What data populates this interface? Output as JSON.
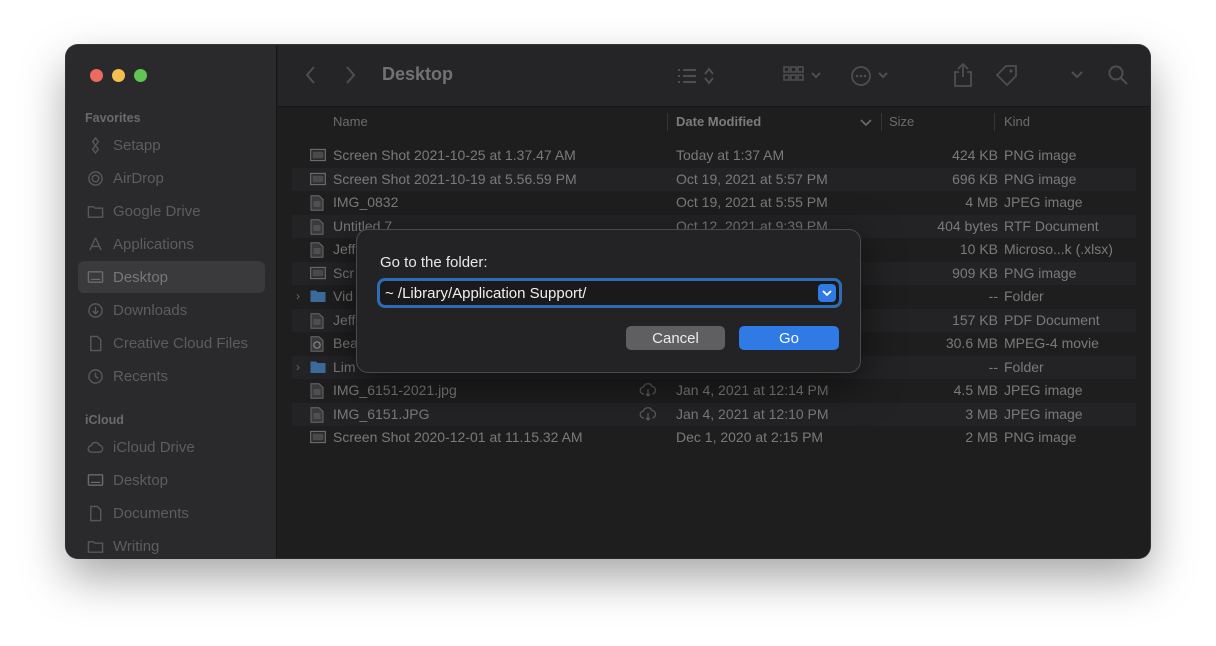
{
  "window": {
    "title": "Desktop"
  },
  "sidebar": {
    "favorites_title": "Favorites",
    "icloud_title": "iCloud",
    "favorites": [
      {
        "label": "Setapp",
        "icon": "setapp-icon"
      },
      {
        "label": "AirDrop",
        "icon": "airdrop-icon"
      },
      {
        "label": "Google Drive",
        "icon": "folder-icon"
      },
      {
        "label": "Applications",
        "icon": "applications-icon"
      },
      {
        "label": "Desktop",
        "icon": "desktop-icon",
        "selected": true
      },
      {
        "label": "Downloads",
        "icon": "downloads-icon"
      },
      {
        "label": "Creative Cloud Files",
        "icon": "document-icon"
      },
      {
        "label": "Recents",
        "icon": "clock-icon"
      }
    ],
    "icloud": [
      {
        "label": "iCloud Drive",
        "icon": "cloud-icon"
      },
      {
        "label": "Desktop",
        "icon": "desktop-icon"
      },
      {
        "label": "Documents",
        "icon": "document-icon"
      },
      {
        "label": "Writing",
        "icon": "folder-icon"
      }
    ]
  },
  "columns": {
    "name": "Name",
    "date": "Date Modified",
    "size": "Size",
    "kind": "Kind"
  },
  "files": [
    {
      "name": "Screen Shot 2021-10-25 at 1.37.47 AM",
      "date": "Today at 1:37 AM",
      "size": "424 KB",
      "kind": "PNG image"
    },
    {
      "name": "Screen Shot 2021-10-19 at 5.56.59 PM",
      "date": "Oct 19, 2021 at 5:57 PM",
      "size": "696 KB",
      "kind": "PNG image"
    },
    {
      "name": "IMG_0832",
      "date": "Oct 19, 2021 at 5:55 PM",
      "size": "4 MB",
      "kind": "JPEG image"
    },
    {
      "name": "Untitled 7",
      "date": "Oct 12, 2021 at 9:39 PM",
      "size": "404 bytes",
      "kind": "RTF Document"
    },
    {
      "name": "Jeff",
      "date": "",
      "size": "10 KB",
      "kind": "Microso...k (.xlsx)"
    },
    {
      "name": "Scr",
      "date": "",
      "size": "909 KB",
      "kind": "PNG image"
    },
    {
      "name": "Vid",
      "date": "",
      "size": "--",
      "kind": "Folder"
    },
    {
      "name": "Jeff",
      "date": "",
      "size": "157 KB",
      "kind": "PDF Document"
    },
    {
      "name": "Bea",
      "date": "",
      "size": "30.6 MB",
      "kind": "MPEG-4 movie"
    },
    {
      "name": "Lim",
      "date": "",
      "size": "--",
      "kind": "Folder"
    },
    {
      "name": "IMG_6151-2021.jpg",
      "date": "Jan 4, 2021 at 12:14 PM",
      "size": "4.5 MB",
      "kind": "JPEG image"
    },
    {
      "name": "IMG_6151.JPG",
      "date": "Jan 4, 2021 at 12:10 PM",
      "size": "3 MB",
      "kind": "JPEG image"
    },
    {
      "name": "Screen Shot 2020-12-01 at 11.15.32 AM",
      "date": "Dec 1, 2020 at 2:15 PM",
      "size": "2 MB",
      "kind": "PNG image"
    }
  ],
  "dialog": {
    "prompt": "Go to the folder:",
    "path_value": "~ /Library/Application Support/",
    "cancel_label": "Cancel",
    "go_label": "Go"
  },
  "colors": {
    "accent": "#2f7ae5",
    "close": "#ed6a5e",
    "minimize": "#f5bf4f",
    "zoom": "#61c554"
  }
}
